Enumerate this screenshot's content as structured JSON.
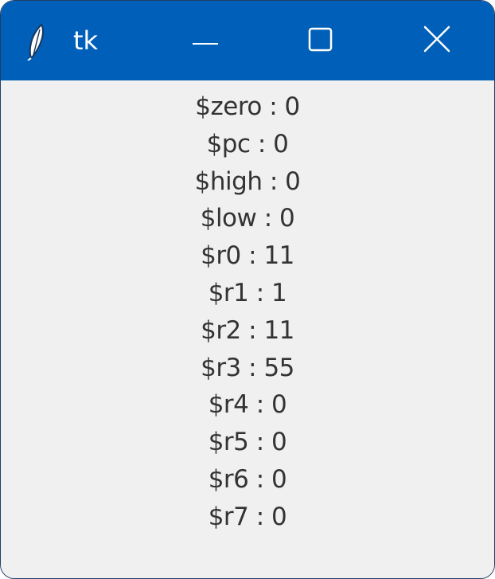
{
  "window": {
    "title": "tk",
    "icon": "feather-icon",
    "controls": {
      "minimize": "minimize-icon",
      "maximize": "maximize-icon",
      "close": "close-icon"
    }
  },
  "registers": [
    "$zero : 0",
    "$pc : 0",
    "$high : 0",
    "$low : 0",
    "$r0 : 11",
    "$r1 : 1",
    "$r2 : 11",
    "$r3 : 55",
    "$r4 : 0",
    "$r5 : 0",
    "$r6 : 0",
    "$r7 : 0"
  ],
  "colors": {
    "titlebar": "#005fb8",
    "background": "#f0f0f0",
    "text": "#333333"
  }
}
